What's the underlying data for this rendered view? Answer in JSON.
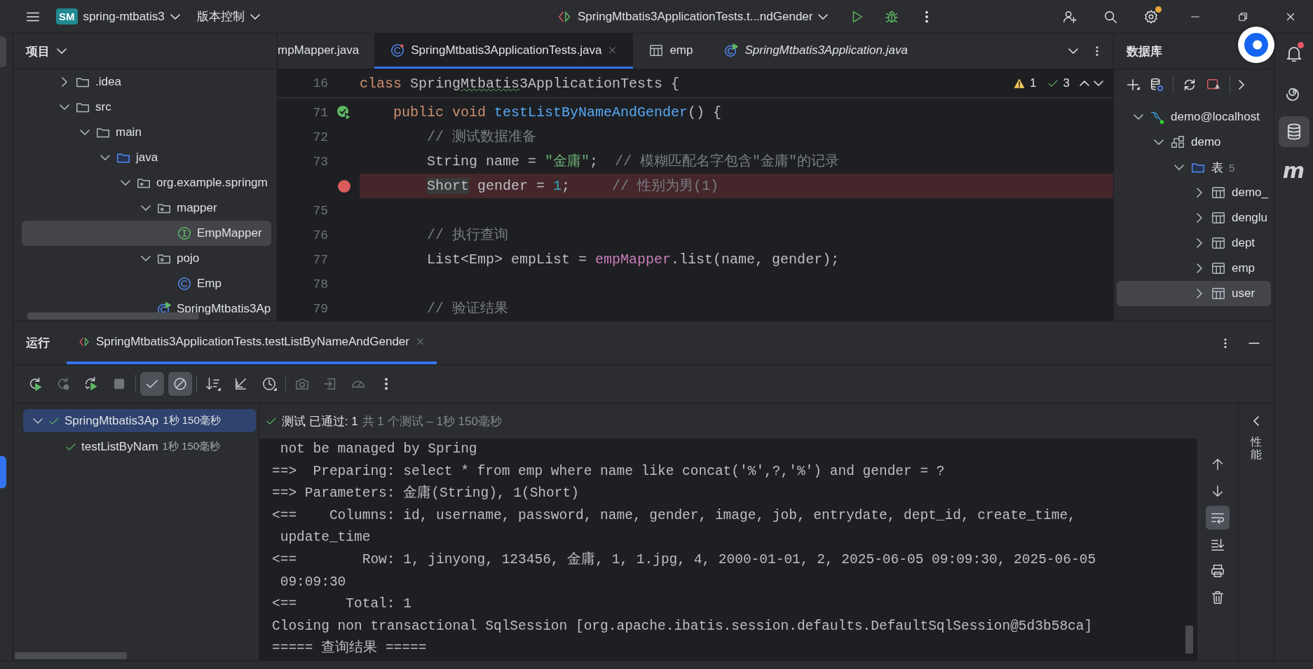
{
  "top_bar": {
    "project_badge": "SM",
    "project_name": "spring-mtbatis3",
    "vcs_menu": "版本控制",
    "run_configuration": "SpringMtbatis3ApplicationTests.t...ndGender",
    "settings_badge": true
  },
  "left_toolbar": [
    {
      "kind": "project",
      "selected": true
    },
    {
      "kind": "run",
      "selected": true
    }
  ],
  "project_panel": {
    "title": "项目",
    "tree": [
      {
        "label": ".idea",
        "kind": "folder",
        "expanded": false,
        "selected": false
      },
      {
        "label": "src",
        "kind": "folder",
        "expanded": true,
        "selected": false,
        "children": [
          {
            "label": "main",
            "kind": "folder",
            "expanded": true,
            "selected": false,
            "children": [
              {
                "label": "java",
                "kind": "source-folder",
                "expanded": true,
                "selected": false,
                "children": [
                  {
                    "label": "org.example.springm",
                    "kind": "package",
                    "expanded": true,
                    "selected": false,
                    "children": [
                      {
                        "label": "mapper",
                        "kind": "package",
                        "expanded": true,
                        "selected": false,
                        "children": [
                          {
                            "label": "EmpMapper",
                            "kind": "interface",
                            "selected": true
                          }
                        ]
                      },
                      {
                        "label": "pojo",
                        "kind": "package",
                        "expanded": true,
                        "selected": false,
                        "children": [
                          {
                            "label": "Emp",
                            "kind": "class",
                            "selected": false
                          }
                        ]
                      },
                      {
                        "label": "SpringMtbatis3Ap",
                        "kind": "app-class",
                        "selected": false
                      }
                    ]
                  }
                ]
              }
            ]
          }
        ]
      }
    ]
  },
  "editor": {
    "tabs": [
      {
        "label": "mpMapper.java",
        "kind": "clipped",
        "selected": false,
        "preview": false
      },
      {
        "label": "SpringMtbatis3ApplicationTests.java",
        "kind": "test-class",
        "selected": true,
        "preview": false
      },
      {
        "label": "emp",
        "kind": "table",
        "selected": false,
        "preview": false
      },
      {
        "label": "SpringMtbatis3Application.java",
        "kind": "app-class",
        "selected": false,
        "preview": true
      }
    ],
    "sticky": {
      "number": "16",
      "tokens": [
        {
          "kind": "keyword",
          "text": "class "
        },
        {
          "kind": "plain",
          "text": "Spring"
        },
        {
          "kind": "typo",
          "text": "Mtbatis"
        },
        {
          "kind": "plain",
          "text": "3ApplicationTests {"
        }
      ]
    },
    "inspections": {
      "warnings": "1",
      "passed": "3"
    },
    "lines": [
      {
        "number": "71",
        "gutter": {
          "kind": "run-test"
        },
        "highlighted": false,
        "tokens": [
          {
            "kind": "keyword",
            "text": "    public void "
          },
          {
            "kind": "method",
            "text": "testListByNameAndGender"
          },
          {
            "kind": "plain",
            "text": "() {"
          }
        ]
      },
      {
        "number": "72",
        "highlighted": false,
        "tokens": [
          {
            "kind": "comment",
            "text": "        // 测试数据准备"
          }
        ]
      },
      {
        "number": "73",
        "highlighted": false,
        "tokens": [
          {
            "kind": "plain",
            "text": "        String name = "
          },
          {
            "kind": "string",
            "text": "\"金庸\""
          },
          {
            "kind": "plain",
            "text": ";  "
          },
          {
            "kind": "comment",
            "text": "// 模糊匹配名字包含\"金庸\"的记录"
          }
        ]
      },
      {
        "gutter": {
          "kind": "breakpoint"
        },
        "highlighted": true,
        "tokens": [
          {
            "kind": "usage",
            "text": "        Short"
          },
          {
            "kind": "plain",
            "text": " gender = "
          },
          {
            "kind": "number",
            "text": "1"
          },
          {
            "kind": "plain",
            "text": ";     "
          },
          {
            "kind": "comment",
            "text": "// 性别为男(1)"
          }
        ]
      },
      {
        "number": "75",
        "highlighted": false
      },
      {
        "number": "76",
        "highlighted": false,
        "tokens": [
          {
            "kind": "comment",
            "text": "        // 执行查询"
          }
        ]
      },
      {
        "number": "77",
        "highlighted": false,
        "tokens": [
          {
            "kind": "plain",
            "text": "        List<Emp> empList = "
          },
          {
            "kind": "field",
            "text": "empMapper"
          },
          {
            "kind": "plain",
            "text": ".list(name, gender);"
          }
        ]
      },
      {
        "number": "78",
        "highlighted": false
      },
      {
        "number": "79",
        "highlighted": false,
        "tokens": [
          {
            "kind": "comment",
            "text": "        // 验证结果"
          }
        ]
      }
    ]
  },
  "database_panel": {
    "title": "数据库",
    "tree": [
      {
        "label": "demo@localhost",
        "kind": "connection",
        "connected": true,
        "expanded": true,
        "selected": false,
        "children": [
          {
            "label": "demo",
            "kind": "schema",
            "expanded": true,
            "selected": false,
            "children": [
              {
                "label": "表",
                "count": "5",
                "kind": "folder",
                "expanded": true,
                "selected": false,
                "children": [
                  {
                    "label": "demo_",
                    "kind": "table",
                    "expanded": false,
                    "selected": false
                  },
                  {
                    "label": "denglu",
                    "kind": "table",
                    "expanded": false,
                    "selected": false
                  },
                  {
                    "label": "dept",
                    "kind": "table",
                    "expanded": false,
                    "selected": false
                  },
                  {
                    "label": "emp",
                    "kind": "table",
                    "expanded": false,
                    "selected": false
                  },
                  {
                    "label": "user",
                    "kind": "table",
                    "expanded": false,
                    "selected": true
                  }
                ]
              }
            ]
          }
        ]
      }
    ]
  },
  "right_toolbar": [
    {
      "kind": "notifications",
      "badge": true,
      "selected": false
    },
    {
      "kind": "ai",
      "selected": false
    },
    {
      "kind": "database",
      "selected": true
    },
    {
      "kind": "plugin",
      "glyph": "m",
      "selected": false
    }
  ],
  "run_panel": {
    "title": "运行",
    "tab": {
      "label": "SpringMtbatis3ApplicationTests.testListByNameAndGender",
      "selected": true
    },
    "toolbar": [
      [
        {
          "kind": "rerun",
          "on": false,
          "disabled": false
        },
        {
          "kind": "rerun-failed",
          "on": false,
          "disabled": true
        },
        {
          "kind": "rerun-auto",
          "on": false,
          "disabled": false
        },
        {
          "kind": "stop",
          "on": false,
          "disabled": true
        }
      ],
      [
        {
          "kind": "show-passed",
          "on": true,
          "disabled": false
        },
        {
          "kind": "show-ignored",
          "on": true,
          "disabled": false
        }
      ],
      [
        {
          "kind": "sort",
          "on": false,
          "disabled": false
        },
        {
          "kind": "import",
          "on": false,
          "disabled": false
        },
        {
          "kind": "history",
          "on": false,
          "disabled": false
        }
      ],
      [
        {
          "kind": "camera",
          "on": false,
          "disabled": true
        },
        {
          "kind": "export",
          "on": false,
          "disabled": true
        },
        {
          "kind": "gauge",
          "on": false,
          "disabled": true
        },
        {
          "kind": "more",
          "on": false,
          "disabled": false
        }
      ]
    ],
    "tests": [
      {
        "label": "SpringMtbatis3Ap",
        "time": "1秒 150毫秒",
        "passed": true,
        "selected": true,
        "expanded": true,
        "children": [
          {
            "label": "testListByNam",
            "time": "1秒 150毫秒",
            "passed": true,
            "selected": false
          }
        ]
      }
    ],
    "status": {
      "passed": true,
      "result": "测试 已通过: 1",
      "summary": "共 1 个测试 – 1秒 150毫秒"
    },
    "console": [
      " not be managed by Spring",
      "==>  Preparing: select * from emp where name like concat('%',?,'%') and gender = ?",
      "==> Parameters: 金庸(String), 1(Short)",
      "<==    Columns: id, username, password, name, gender, image, job, entrydate, dept_id, create_time,",
      " update_time",
      "<==        Row: 1, jinyong, 123456, 金庸, 1, 1.jpg, 4, 2000-01-01, 2, 2025-06-05 09:09:30, 2025-06-05",
      " 09:09:30",
      "<==      Total: 1",
      "Closing non transactional SqlSession [org.apache.ibatis.session.defaults.DefaultSqlSession@5d3b58ca]",
      "===== 查询结果 ====="
    ],
    "console_tools": [
      {
        "kind": "up",
        "on": false
      },
      {
        "kind": "down",
        "on": false
      },
      {
        "kind": "wrap",
        "on": true
      },
      {
        "kind": "scroll-end",
        "on": false
      },
      {
        "kind": "print",
        "on": false
      },
      {
        "kind": "clear",
        "on": false
      }
    ],
    "side_label": "性能"
  }
}
